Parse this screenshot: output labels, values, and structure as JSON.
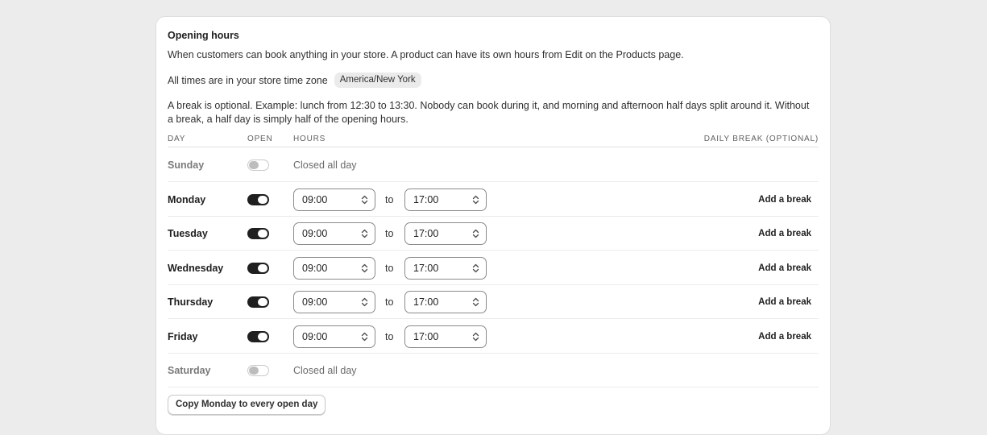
{
  "card": {
    "title": "Opening hours",
    "description": "When customers can book anything in your store. A product can have its own hours from Edit on the Products page.",
    "timezone_label": "All times are in your store time zone",
    "timezone_value": "America/New York",
    "break_note": "A break is optional. Example: lunch from 12:30 to 13:30. Nobody can book during it, and morning and afternoon half days split around it. Without a break, a half day is simply half of the opening hours."
  },
  "table": {
    "headers": {
      "day": "DAY",
      "open": "OPEN",
      "hours": "HOURS",
      "break": "DAILY BREAK (OPTIONAL)"
    },
    "to_label": "to",
    "closed_label": "Closed all day",
    "add_break_label": "Add a break",
    "days": [
      {
        "name": "Sunday",
        "open": false
      },
      {
        "name": "Monday",
        "open": true,
        "from": "09:00",
        "to": "17:00"
      },
      {
        "name": "Tuesday",
        "open": true,
        "from": "09:00",
        "to": "17:00"
      },
      {
        "name": "Wednesday",
        "open": true,
        "from": "09:00",
        "to": "17:00"
      },
      {
        "name": "Thursday",
        "open": true,
        "from": "09:00",
        "to": "17:00"
      },
      {
        "name": "Friday",
        "open": true,
        "from": "09:00",
        "to": "17:00"
      },
      {
        "name": "Saturday",
        "open": false
      }
    ]
  },
  "copy_button": "Copy Monday to every open day",
  "icons": {
    "select_chevron": "chevron-up-down-icon"
  }
}
